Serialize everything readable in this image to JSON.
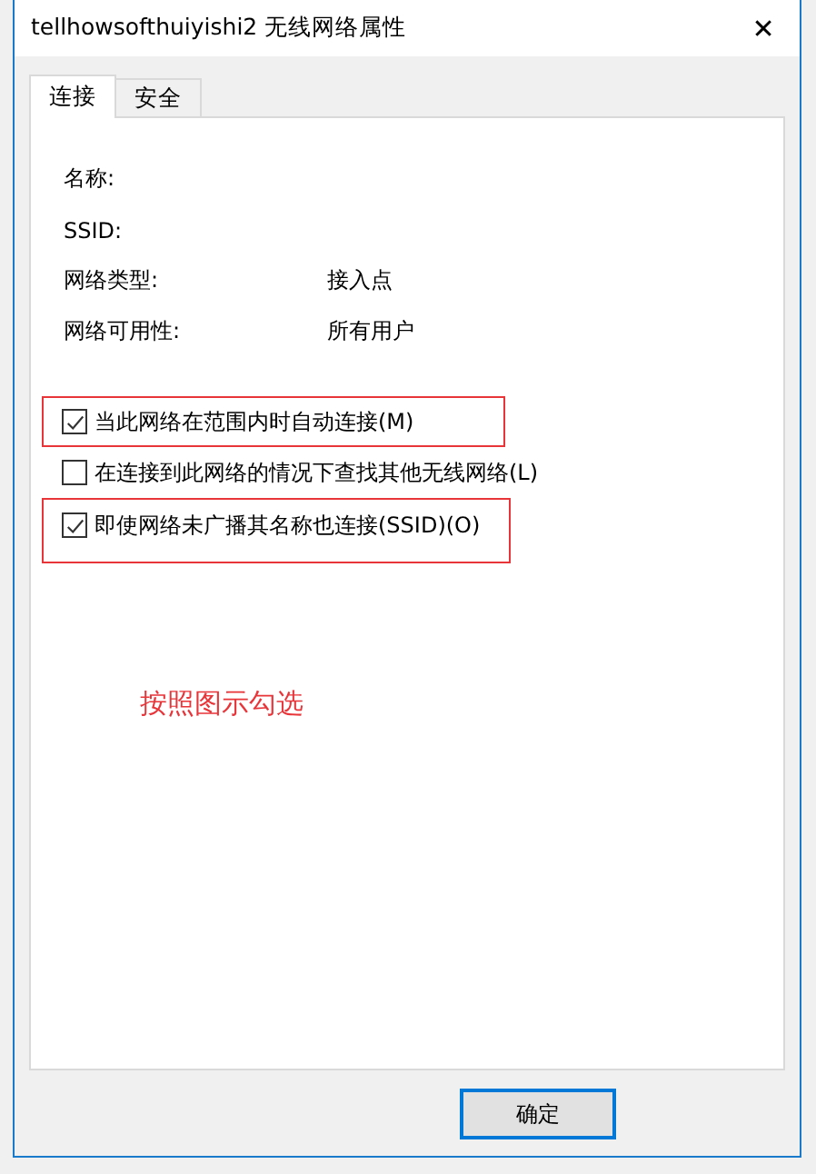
{
  "window": {
    "title": "tellhowsofthuiyishi2 无线网络属性",
    "close": "✕"
  },
  "tabs": [
    {
      "label": "连接",
      "selected": true
    },
    {
      "label": "安全",
      "selected": false
    }
  ],
  "properties": [
    {
      "label": "名称:"
    },
    {
      "label": "SSID:"
    },
    {
      "label": "网络类型:",
      "value": "接入点"
    },
    {
      "label": "网络可用性:",
      "value": "所有用户"
    }
  ],
  "options": [
    {
      "label": "当此网络在范围内时自动连接(M)",
      "checked": true,
      "highlighted": true
    },
    {
      "label": "在连接到此网络的情况下查找其他无线网络(L)",
      "checked": false,
      "highlighted": false
    },
    {
      "label": "即使网络未广播其名称也连接(SSID)(O)",
      "checked": true,
      "highlighted": true
    }
  ],
  "annotation": "按照图示勾选",
  "buttons": [
    {
      "label": "确定",
      "default": true
    }
  ]
}
